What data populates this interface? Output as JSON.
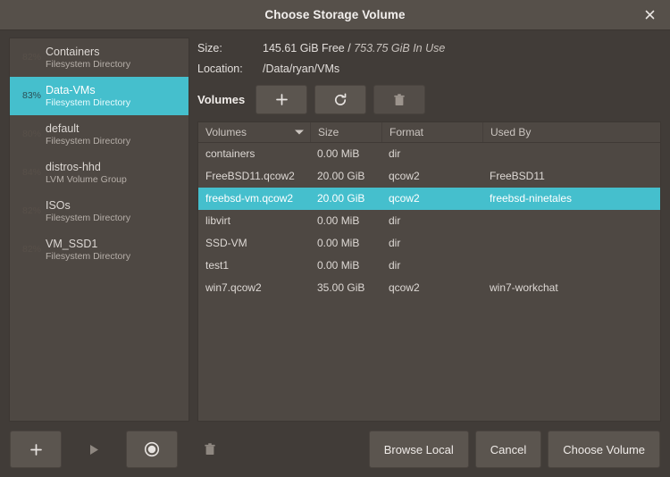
{
  "window": {
    "title": "Choose Storage Volume",
    "close_icon": "close-icon"
  },
  "theme": {
    "accent": "#45bfcd",
    "window_bg": "#413c38",
    "titlebar_bg": "#56504a",
    "panel_bg": "#4e4843",
    "button_bg": "#5b554f",
    "text": "#ddd8d4"
  },
  "sidebar": {
    "pools": [
      {
        "percent": "82%",
        "name": "Containers",
        "type": "Filesystem Directory",
        "selected": false
      },
      {
        "percent": "83%",
        "name": "Data-VMs",
        "type": "Filesystem Directory",
        "selected": true
      },
      {
        "percent": "80%",
        "name": "default",
        "type": "Filesystem Directory",
        "selected": false
      },
      {
        "percent": "84%",
        "name": "distros-hhd",
        "type": "LVM Volume Group",
        "selected": false
      },
      {
        "percent": "82%",
        "name": "ISOs",
        "type": "Filesystem Directory",
        "selected": false
      },
      {
        "percent": "82%",
        "name": "VM_SSD1",
        "type": "Filesystem Directory",
        "selected": false
      }
    ],
    "actions": [
      {
        "icon": "plus-icon",
        "name": "add-pool-button",
        "enabled": true,
        "style": "raised"
      },
      {
        "icon": "play-icon",
        "name": "start-pool-button",
        "enabled": false,
        "style": "flat"
      },
      {
        "icon": "stop-icon",
        "name": "stop-pool-button",
        "enabled": true,
        "style": "raised"
      },
      {
        "icon": "trash-icon",
        "name": "delete-pool-button",
        "enabled": false,
        "style": "flat"
      }
    ]
  },
  "details": {
    "size_label": "Size:",
    "size_free": "145.61 GiB Free",
    "size_separator": "/",
    "size_in_use": "753.75 GiB In Use",
    "location_label": "Location:",
    "location_value": "/Data/ryan/VMs"
  },
  "volumes_toolbar": {
    "label": "Volumes",
    "buttons": [
      {
        "icon": "plus-icon",
        "name": "new-volume-button",
        "enabled": true
      },
      {
        "icon": "refresh-icon",
        "name": "refresh-volumes-button",
        "enabled": true
      },
      {
        "icon": "trash-icon",
        "name": "delete-volume-button",
        "enabled": false
      }
    ]
  },
  "volumes_table": {
    "columns": [
      {
        "label": "Volumes",
        "sorted": true
      },
      {
        "label": "Size",
        "sorted": false
      },
      {
        "label": "Format",
        "sorted": false
      },
      {
        "label": "Used By",
        "sorted": false
      }
    ],
    "rows": [
      {
        "name": "containers",
        "size": "0.00 MiB",
        "format": "dir",
        "used_by": "",
        "selected": false
      },
      {
        "name": "FreeBSD11.qcow2",
        "size": "20.00 GiB",
        "format": "qcow2",
        "used_by": "FreeBSD11",
        "selected": false
      },
      {
        "name": "freebsd-vm.qcow2",
        "size": "20.00 GiB",
        "format": "qcow2",
        "used_by": "freebsd-ninetales",
        "selected": true
      },
      {
        "name": "libvirt",
        "size": "0.00 MiB",
        "format": "dir",
        "used_by": "",
        "selected": false
      },
      {
        "name": "SSD-VM",
        "size": "0.00 MiB",
        "format": "dir",
        "used_by": "",
        "selected": false
      },
      {
        "name": "test1",
        "size": "0.00 MiB",
        "format": "dir",
        "used_by": "",
        "selected": false
      },
      {
        "name": "win7.qcow2",
        "size": "35.00 GiB",
        "format": "qcow2",
        "used_by": "win7-workchat",
        "selected": false
      }
    ]
  },
  "footer": {
    "browse_local": "Browse Local",
    "cancel": "Cancel",
    "choose_volume": "Choose Volume"
  }
}
